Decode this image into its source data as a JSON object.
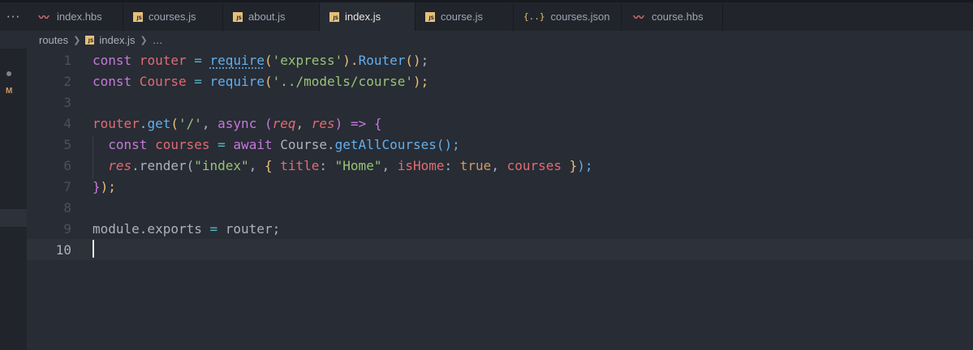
{
  "tabs": [
    {
      "label": "index.hbs",
      "icon": "handlebars-icon",
      "active": false
    },
    {
      "label": "courses.js",
      "icon": "js-file-icon",
      "active": false
    },
    {
      "label": "about.js",
      "icon": "js-file-icon",
      "active": false
    },
    {
      "label": "index.js",
      "icon": "js-file-icon",
      "active": true
    },
    {
      "label": "course.js",
      "icon": "js-file-icon",
      "active": false
    },
    {
      "label": "courses.json",
      "icon": "json-file-icon",
      "active": false
    },
    {
      "label": "course.hbs",
      "icon": "handlebars-icon",
      "active": false
    }
  ],
  "tabs_overflow": "···",
  "breadcrumb": {
    "folder": "routes",
    "file": "index.js",
    "symbol": "…"
  },
  "gutter": {
    "modified_marker": "M"
  },
  "editor": {
    "line_numbers": [
      "1",
      "2",
      "3",
      "4",
      "5",
      "6",
      "7",
      "8",
      "9",
      "10"
    ],
    "current_line": "10",
    "lines": {
      "l1": {
        "c1": "const",
        "c2": " router ",
        "c3": "=",
        "c4": " ",
        "c5": "require",
        "c6": "(",
        "c7": "'express'",
        "c8": ").",
        "c9": "Router",
        "c10": "()",
        "c11": ";"
      },
      "l2": {
        "c1": "const",
        "c2": " Course ",
        "c3": "=",
        "c4": " ",
        "c5": "require",
        "c6": "(",
        "c7": "'../models/course'",
        "c8": ");"
      },
      "l4": {
        "c1": "router",
        "c2": ".",
        "c3": "get",
        "c4": "(",
        "c5": "'/'",
        "c6": ", ",
        "c7": "async",
        "c8": " (",
        "c9": "req",
        "c10": ", ",
        "c11": "res",
        "c12": ") ",
        "c13": "=>",
        "c14": " ",
        "c15": "{"
      },
      "l5": {
        "c1": "  const",
        "c2": " courses ",
        "c3": "=",
        "c4": " ",
        "c5": "await",
        "c6": " Course.",
        "c7": "getAllCourses",
        "c8": "();"
      },
      "l6": {
        "c1": "  ",
        "c2": "res",
        "c3": ".render(",
        "c4": "\"index\"",
        "c5": ", ",
        "c6": "{",
        "c7": " ",
        "c8": "title",
        "c9": ": ",
        "c10": "\"Home\"",
        "c11": ", ",
        "c12": "isHome",
        "c13": ": ",
        "c14": "true",
        "c15": ", ",
        "c16": "courses",
        "c17": " ",
        "c18": "}",
        "c19": ");"
      },
      "l7": {
        "c1": "}",
        "c2": ");"
      },
      "l9": {
        "c1": "module.exports ",
        "c2": "=",
        "c3": " router;"
      }
    }
  },
  "colors": {
    "background": "#282c34",
    "keyword": "#c678dd",
    "function": "#61afef",
    "string": "#98c379",
    "variable": "#e06c75",
    "boolean": "#d19a66"
  }
}
